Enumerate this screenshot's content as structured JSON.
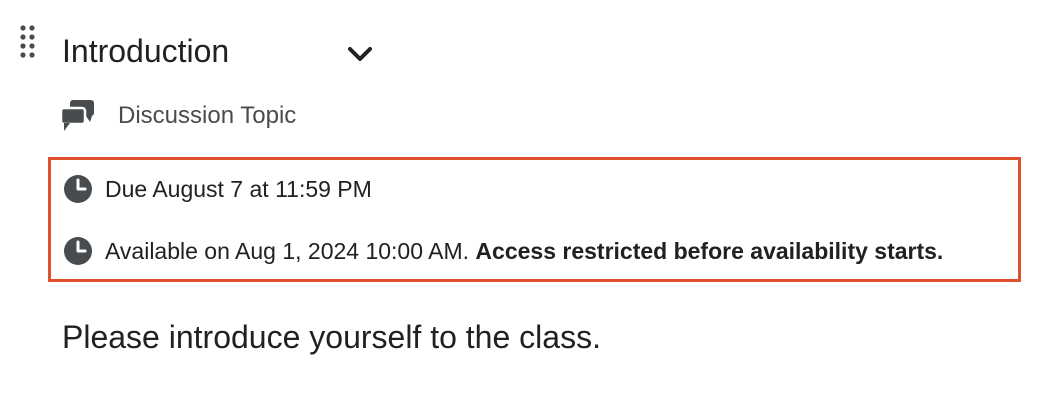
{
  "item": {
    "title": "Introduction",
    "type_label": "Discussion Topic",
    "description": "Please introduce yourself to the class."
  },
  "dates": {
    "due": "Due August 7 at 11:59 PM",
    "available": "Available on Aug 1, 2024 10:00 AM.",
    "restriction": "Access restricted before availability starts."
  },
  "icons": {
    "drag": "drag-handle-icon",
    "expand": "chevron-down-icon",
    "type": "discussion-icon",
    "due": "clock-icon",
    "available": "clock-icon"
  },
  "colors": {
    "highlight_border": "#e0512f",
    "text": "#202122",
    "muted_text": "#494c4e",
    "icon": "#494c4e"
  }
}
